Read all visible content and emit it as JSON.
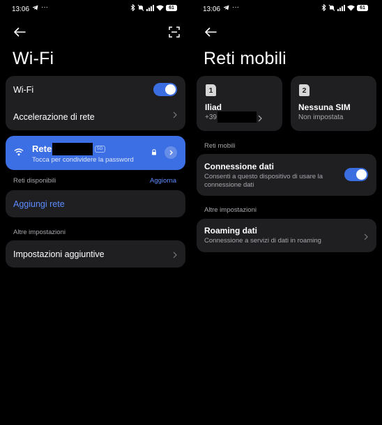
{
  "status": {
    "time": "13:06",
    "battery": "61"
  },
  "wifi_screen": {
    "title": "Wi-Fi",
    "wifi_toggle_label": "Wi-Fi",
    "wifi_enabled": true,
    "acceleration_label": "Accelerazione di rete",
    "connected_network": {
      "name_prefix": "Rete",
      "band_badge": "5G",
      "subtitle": "Tocca per condividere la password"
    },
    "available_networks_label": "Reti disponibili",
    "refresh_label": "Aggiorna",
    "add_network_label": "Aggiungi rete",
    "other_settings_label": "Altre impostazioni",
    "additional_settings_label": "Impostazioni aggiuntive"
  },
  "mobile_screen": {
    "title": "Reti mobili",
    "sims": [
      {
        "number": "1",
        "name": "Iliad",
        "detail": "+39"
      },
      {
        "number": "2",
        "name": "Nessuna SIM",
        "detail": "Non impostata"
      }
    ],
    "mobile_networks_label": "Reti mobili",
    "data_connection": {
      "label": "Connessione dati",
      "description": "Consenti a questo dispositivo di usare la connessione dati",
      "enabled": true
    },
    "other_settings_label": "Altre impostazioni",
    "roaming": {
      "label": "Roaming dati",
      "description": "Connessione a servizi di dati in roaming"
    }
  },
  "colors": {
    "accent": "#3b6ee0",
    "card": "#1f1f22",
    "background": "#000000",
    "link": "#5c8cff"
  }
}
